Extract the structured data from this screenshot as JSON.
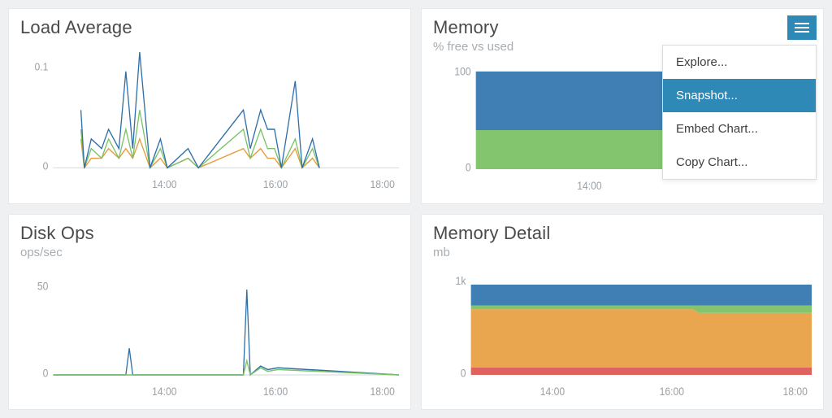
{
  "colors": {
    "blue": "#3f7fb3",
    "green": "#83c56e",
    "orange": "#e9a64e",
    "red": "#de6260",
    "accent": "#2f89b6"
  },
  "menu": {
    "items": [
      "Explore...",
      "Snapshot...",
      "Embed Chart...",
      "Copy Chart..."
    ],
    "selected_index": 1
  },
  "panels": {
    "load": {
      "title": "Load Average",
      "subtitle": "",
      "y_ticks": [
        "0.1",
        "0"
      ],
      "x_ticks": [
        "14:00",
        "16:00",
        "18:00"
      ]
    },
    "memory": {
      "title": "Memory",
      "subtitle": "% free vs used",
      "y_ticks": [
        "100",
        "0"
      ],
      "x_ticks": [
        "14:00"
      ]
    },
    "disk": {
      "title": "Disk Ops",
      "subtitle": "ops/sec",
      "y_ticks": [
        "50",
        "0"
      ],
      "x_ticks": [
        "14:00",
        "16:00",
        "18:00"
      ]
    },
    "memdetail": {
      "title": "Memory Detail",
      "subtitle": "mb",
      "y_ticks": [
        "1k",
        "0"
      ],
      "x_ticks": [
        "14:00",
        "16:00",
        "18:00"
      ]
    }
  },
  "chart_data": [
    {
      "id": "load",
      "type": "line",
      "title": "Load Average",
      "xlabel": "",
      "ylabel": "",
      "ylim": [
        0,
        0.12
      ],
      "x_range_labels": [
        "14:00",
        "16:00",
        "18:00"
      ],
      "series": [
        {
          "name": "load-blue",
          "x": [
            0.08,
            0.09,
            0.11,
            0.14,
            0.16,
            0.19,
            0.21,
            0.23,
            0.25,
            0.28,
            0.31,
            0.33,
            0.39,
            0.42,
            0.55,
            0.57,
            0.6,
            0.62,
            0.64,
            0.66,
            0.7,
            0.72,
            0.75,
            0.77
          ],
          "values": [
            0.06,
            0.0,
            0.03,
            0.02,
            0.04,
            0.02,
            0.1,
            0.02,
            0.12,
            0.0,
            0.03,
            0.0,
            0.02,
            0.0,
            0.06,
            0.02,
            0.06,
            0.04,
            0.04,
            0.0,
            0.09,
            0.0,
            0.03,
            0.0
          ]
        },
        {
          "name": "load-green",
          "x": [
            0.08,
            0.09,
            0.11,
            0.14,
            0.16,
            0.19,
            0.21,
            0.23,
            0.25,
            0.28,
            0.31,
            0.33,
            0.39,
            0.42,
            0.55,
            0.57,
            0.6,
            0.62,
            0.64,
            0.66,
            0.7,
            0.72,
            0.75,
            0.77
          ],
          "values": [
            0.04,
            0.0,
            0.02,
            0.01,
            0.03,
            0.01,
            0.04,
            0.01,
            0.06,
            0.0,
            0.02,
            0.0,
            0.01,
            0.0,
            0.04,
            0.01,
            0.04,
            0.02,
            0.02,
            0.0,
            0.03,
            0.0,
            0.02,
            0.0
          ]
        },
        {
          "name": "load-orange",
          "x": [
            0.08,
            0.09,
            0.11,
            0.14,
            0.16,
            0.19,
            0.21,
            0.23,
            0.25,
            0.28,
            0.31,
            0.33,
            0.39,
            0.42,
            0.55,
            0.57,
            0.6,
            0.62,
            0.64,
            0.66,
            0.7,
            0.72,
            0.75,
            0.77
          ],
          "values": [
            0.03,
            0.0,
            0.01,
            0.01,
            0.02,
            0.01,
            0.02,
            0.01,
            0.03,
            0.0,
            0.01,
            0.0,
            0.01,
            0.0,
            0.02,
            0.01,
            0.02,
            0.01,
            0.01,
            0.0,
            0.02,
            0.0,
            0.01,
            0.0
          ]
        }
      ]
    },
    {
      "id": "memory",
      "type": "area",
      "title": "Memory",
      "subtitle": "% free vs used",
      "xlabel": "",
      "ylabel": "",
      "ylim": [
        0,
        100
      ],
      "x_range_labels": [
        "14:00"
      ],
      "stack": true,
      "series": [
        {
          "name": "used-green",
          "x": [
            0.0,
            0.5,
            1.0
          ],
          "values": [
            40,
            40,
            40
          ]
        },
        {
          "name": "free-blue",
          "x": [
            0.0,
            0.5,
            1.0
          ],
          "values": [
            60,
            60,
            60
          ]
        }
      ]
    },
    {
      "id": "disk",
      "type": "line",
      "title": "Disk Ops",
      "subtitle": "ops/sec",
      "xlabel": "",
      "ylabel": "",
      "ylim": [
        0,
        55
      ],
      "x_range_labels": [
        "14:00",
        "16:00",
        "18:00"
      ],
      "series": [
        {
          "name": "disk-blue",
          "x": [
            0.0,
            0.21,
            0.22,
            0.23,
            0.55,
            0.56,
            0.57,
            0.6,
            0.62,
            0.65,
            1.0
          ],
          "values": [
            0,
            0,
            15,
            0,
            0,
            48,
            0,
            5,
            3,
            4,
            0
          ]
        },
        {
          "name": "disk-green",
          "x": [
            0.0,
            0.55,
            0.56,
            0.57,
            0.6,
            0.62,
            0.65,
            1.0
          ],
          "values": [
            0,
            0,
            8,
            0,
            4,
            2,
            3,
            0
          ]
        }
      ]
    },
    {
      "id": "memdetail",
      "type": "area",
      "title": "Memory Detail",
      "subtitle": "mb",
      "xlabel": "",
      "ylabel": "",
      "ylim": [
        0,
        1000
      ],
      "x_range_labels": [
        "14:00",
        "16:00",
        "18:00"
      ],
      "stack": true,
      "series": [
        {
          "name": "red",
          "x": [
            0.0,
            0.65,
            0.67,
            1.0
          ],
          "values": [
            80,
            80,
            80,
            80
          ]
        },
        {
          "name": "orange",
          "x": [
            0.0,
            0.65,
            0.67,
            1.0
          ],
          "values": [
            620,
            620,
            580,
            580
          ]
        },
        {
          "name": "green",
          "x": [
            0.0,
            0.65,
            0.67,
            1.0
          ],
          "values": [
            40,
            40,
            80,
            80
          ]
        },
        {
          "name": "blue",
          "x": [
            0.0,
            0.65,
            0.67,
            1.0
          ],
          "values": [
            220,
            220,
            220,
            220
          ]
        }
      ]
    }
  ]
}
